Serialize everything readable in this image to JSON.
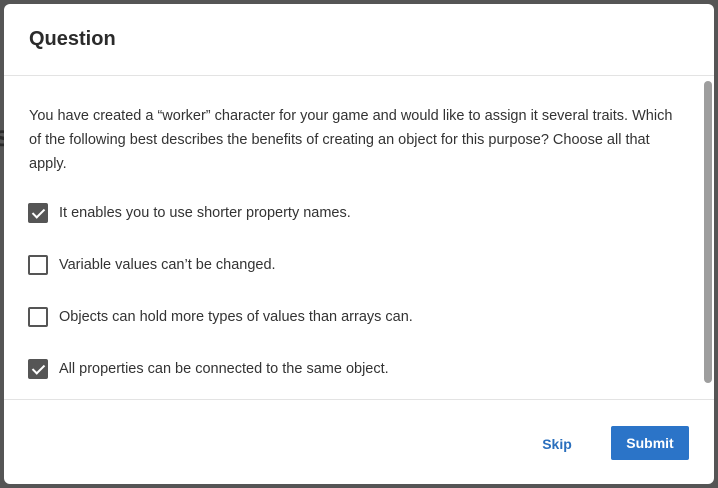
{
  "dialog": {
    "title": "Question",
    "question": "You have created a “worker” character for your game and would like to assign it several traits. Which of the following best describes the benefits of creating an object for this purpose? Choose all that apply.",
    "options": [
      {
        "label": "It enables you to use shorter property names.",
        "checked": true
      },
      {
        "label": "Variable values can’t be changed.",
        "checked": false
      },
      {
        "label": "Objects can hold more types of values than arrays can.",
        "checked": false
      },
      {
        "label": "All properties can be connected to the same object.",
        "checked": true
      }
    ],
    "skip_label": "Skip",
    "submit_label": "Submit"
  },
  "colors": {
    "accent": "#2b74c8",
    "link": "#2a6fbd",
    "checkbox": "#555555",
    "backdrop": "#555555"
  }
}
